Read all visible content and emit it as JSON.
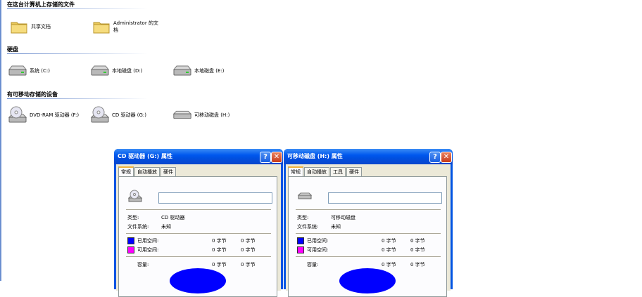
{
  "groups": {
    "files": {
      "title": "在这台计算机上存储的文件",
      "items": [
        {
          "label": "共享文档",
          "icon": "folder-icon"
        },
        {
          "label": "Administrator 的文\n档",
          "icon": "folder-icon"
        }
      ]
    },
    "hdd": {
      "title": "硬盘",
      "items": [
        {
          "label": "系统 (C:)",
          "icon": "hard-drive-icon"
        },
        {
          "label": "本地磁盘 (D:)",
          "icon": "hard-drive-icon"
        },
        {
          "label": "本地磁盘 (E:)",
          "icon": "hard-drive-icon"
        }
      ]
    },
    "removable": {
      "title": "有可移动存储的设备",
      "items": [
        {
          "label": "DVD-RAM 驱动器 (F:)",
          "icon": "dvd-drive-icon"
        },
        {
          "label": "CD 驱动器 (G:)",
          "icon": "cd-drive-icon"
        },
        {
          "label": "可移动磁盘 (H:)",
          "icon": "removable-disk-icon"
        }
      ]
    }
  },
  "dialogs": [
    {
      "title": "CD 驱动器 (G:) 属性",
      "tabs": [
        "常规",
        "自动播放",
        "硬件"
      ],
      "type_label": "类型:",
      "type_value": "CD 驱动器",
      "fs_label": "文件系统:",
      "fs_value": "未知",
      "used_label": "已用空间:",
      "used_bytes": "0 字节",
      "used_size": "0 字节",
      "free_label": "可用空间:",
      "free_bytes": "0 字节",
      "free_size": "0 字节",
      "cap_label": "容量:",
      "cap_bytes": "0 字节",
      "cap_size": "0 字节"
    },
    {
      "title": "可移动磁盘 (H:) 属性",
      "tabs": [
        "常规",
        "自动播放",
        "工具",
        "硬件"
      ],
      "type_label": "类型:",
      "type_value": "可移动磁盘",
      "fs_label": "文件系统:",
      "fs_value": "未知",
      "used_label": "已用空间:",
      "used_bytes": "0 字节",
      "used_size": "0 字节",
      "free_label": "可用空间:",
      "free_bytes": "0 字节",
      "free_size": "0 字节",
      "cap_label": "容量:",
      "cap_bytes": "0 字节",
      "cap_size": "0 字节"
    }
  ],
  "title_buttons": {
    "help": "?",
    "close": "✕"
  },
  "colors": {
    "used_space": "#0000ff",
    "free_space": "#ff00ff",
    "titlebar": "#0054e3",
    "dialog_face": "#ece9d8"
  }
}
